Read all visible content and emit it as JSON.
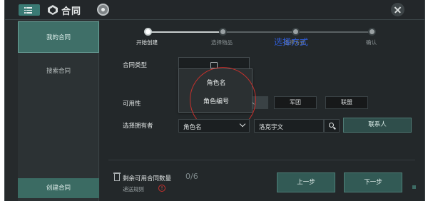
{
  "app": {
    "title": "合同"
  },
  "sidebar": {
    "items": [
      {
        "label": "我的合同",
        "active": true
      },
      {
        "label": "搜索合同",
        "active": false
      }
    ],
    "create_label": "创建合同"
  },
  "steps": {
    "items": [
      {
        "label": "开始创建",
        "active": true
      },
      {
        "label": "选择物品",
        "active": false
      },
      {
        "label": "选择方式",
        "active": false
      },
      {
        "label": "确认",
        "active": false
      }
    ],
    "overlay_caption": "选择方式"
  },
  "form": {
    "contract_type_label": "合同类型",
    "contract_type_menu": {
      "options": [
        "角色名",
        "角色编号"
      ]
    },
    "availability_label": "可用性",
    "availability_options": [
      {
        "label": "人",
        "selected": true
      },
      {
        "label": "军团",
        "selected": false
      },
      {
        "label": "联盟",
        "selected": false
      }
    ],
    "owner_label": "选择拥有者",
    "owner_type_value": "角色名",
    "owner_name_value": "洛克宇文",
    "contact_button": "联系人"
  },
  "footer": {
    "remaining_label": "剩余可用合同数量",
    "remaining_count": "0/6",
    "rules_link": "递送规则",
    "info_glyph": "!",
    "prev_button": "上一步",
    "next_button": "下一步"
  },
  "icons": [
    "menu-icon",
    "app-logo-icon",
    "record-icon",
    "close-icon",
    "image-icon",
    "chevron-down-icon",
    "search-icon",
    "trash-icon",
    "info-icon"
  ],
  "colors": {
    "accent": "#3f6f68",
    "annotation_red": "#c8302c",
    "annotation_blue": "#2f5cd6"
  }
}
